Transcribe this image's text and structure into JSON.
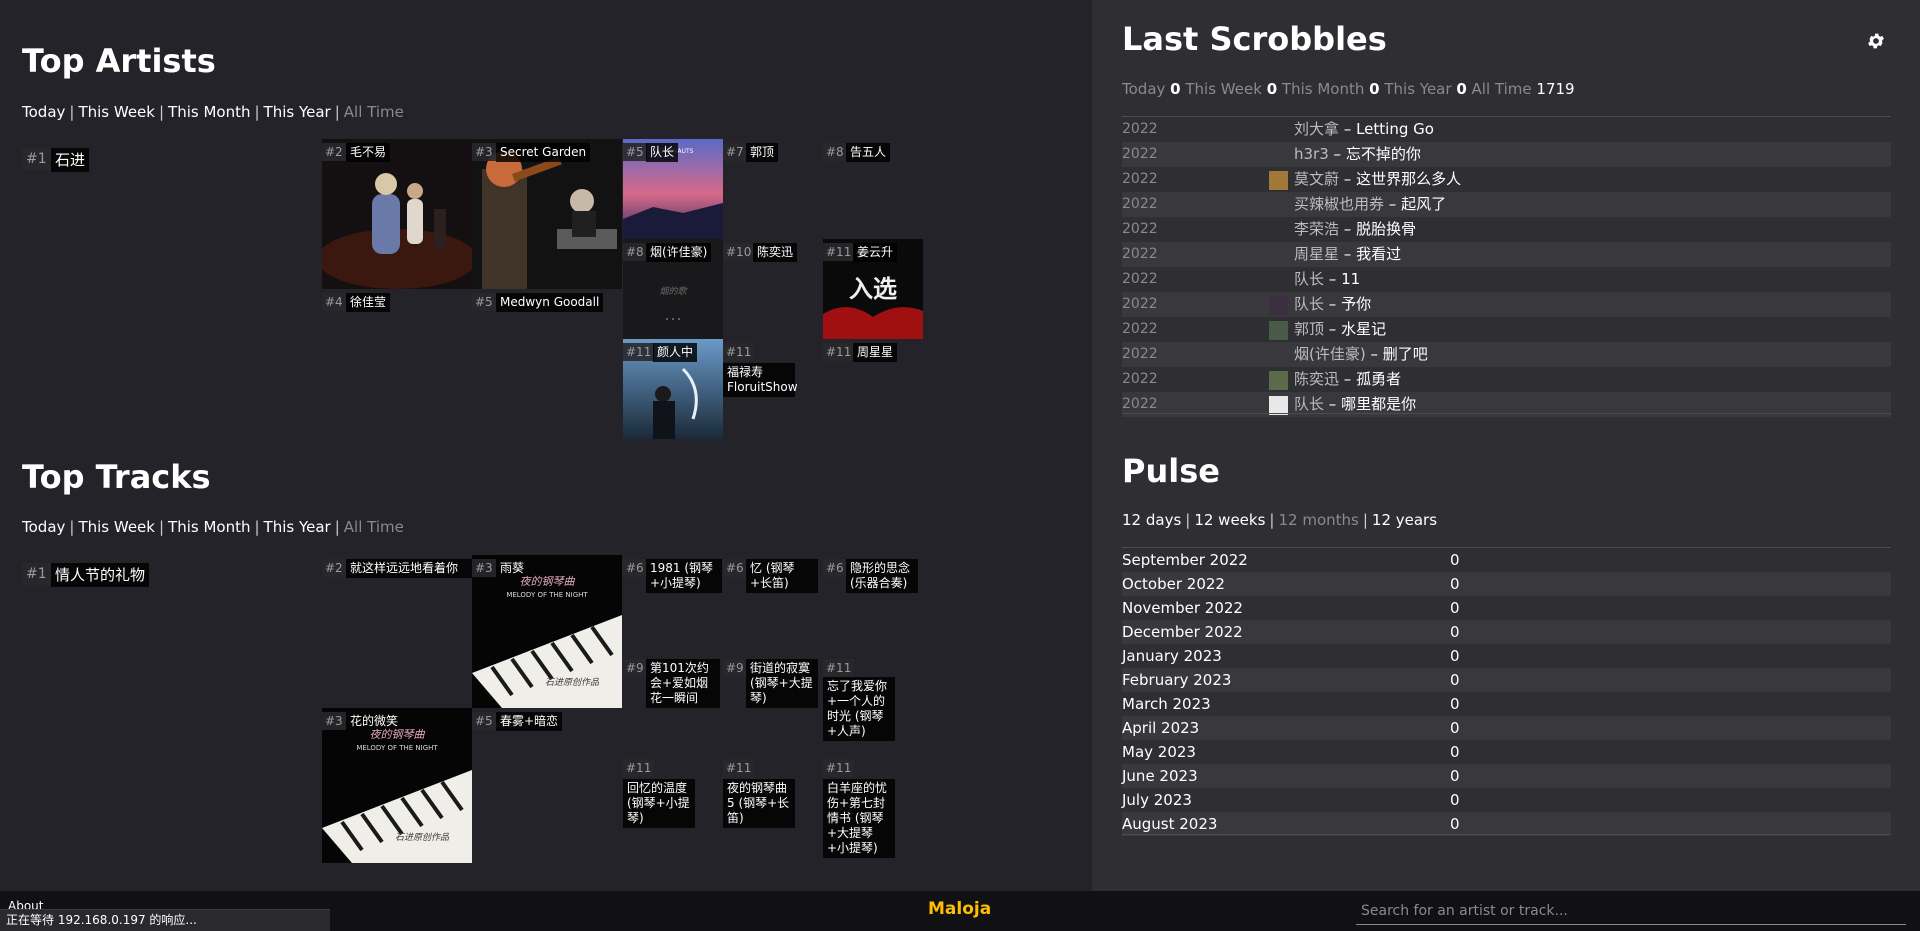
{
  "artists": {
    "title": "Top Artists",
    "ranges": [
      "Today",
      "This Week",
      "This Month",
      "This Year",
      "All Time"
    ],
    "tiles": [
      {
        "rank": "#1",
        "name": "石进"
      },
      {
        "rank": "#2",
        "name": "毛不易"
      },
      {
        "rank": "#3",
        "name": "Secret Garden"
      },
      {
        "rank": "#4",
        "name": "徐佳莹"
      },
      {
        "rank": "#5",
        "name": "Medwyn Goodall"
      },
      {
        "rank": "#5",
        "name": "队长"
      },
      {
        "rank": "#7",
        "name": "郭顶"
      },
      {
        "rank": "#8",
        "name": "告五人"
      },
      {
        "rank": "#8",
        "name": "烟(许佳豪)"
      },
      {
        "rank": "#10",
        "name": "陈奕迅"
      },
      {
        "rank": "#11",
        "name": "姜云升"
      },
      {
        "rank": "#11",
        "name": "颜人中"
      },
      {
        "rank": "#11",
        "name": "福禄寿 FloruitShow"
      },
      {
        "rank": "#11",
        "name": "周星星"
      }
    ],
    "art_texts": {
      "astronaut": "ASTRONAUTS",
      "yan": "烟的歌",
      "jiang": "入选"
    }
  },
  "tracks": {
    "title": "Top Tracks",
    "ranges": [
      "Today",
      "This Week",
      "This Month",
      "This Year",
      "All Time"
    ],
    "tiles": [
      {
        "rank": "#1",
        "name": "情人节的礼物"
      },
      {
        "rank": "#2",
        "name": "就这样远远地看着你"
      },
      {
        "rank": "#3",
        "name": "雨葵"
      },
      {
        "rank": "#6",
        "name": "1981 (钢琴+小提琴)"
      },
      {
        "rank": "#6",
        "name": "忆 (钢琴+长笛)"
      },
      {
        "rank": "#6",
        "name": "隐形的思念 (乐器合奏)"
      },
      {
        "rank": "#9",
        "name": "第101次约会+爱如烟花一瞬间"
      },
      {
        "rank": "#9",
        "name": "街道的寂寞 (钢琴+大提琴)"
      },
      {
        "rank": "#11",
        "name": "忘了我爱你+一个人的时光 (钢琴+人声)"
      },
      {
        "rank": "#3",
        "name": "花的微笑"
      },
      {
        "rank": "#5",
        "name": "春雾+暗恋"
      },
      {
        "rank": "#11",
        "name": "回忆的温度 (钢琴+小提琴)"
      },
      {
        "rank": "#11",
        "name": "夜的钢琴曲5 (钢琴+长笛)"
      },
      {
        "rank": "#11",
        "name": "白羊座的忧伤+第七封情书 (钢琴+大提琴+小提琴)"
      }
    ],
    "cover_texts": {
      "title": "夜的钢琴曲",
      "subtitle": "MELODY OF THE NIGHT",
      "caption": "石进原创作品"
    }
  },
  "scrobbles": {
    "title": "Last Scrobbles",
    "settings_icon": "gear-icon",
    "stats": {
      "today_label": "Today",
      "today": "0",
      "week_label": "This Week",
      "week": "0",
      "month_label": "This Month",
      "month": "0",
      "year_label": "This Year",
      "year": "0",
      "all_label": "All Time",
      "all": "1719"
    },
    "rows": [
      {
        "time": "2022",
        "artist": "刘大拿",
        "title": "Letting Go",
        "thumb": ""
      },
      {
        "time": "2022",
        "artist": "h3r3",
        "title": "忘不掉的你",
        "thumb": ""
      },
      {
        "time": "2022",
        "artist": "莫文蔚",
        "title": "这世界那么多人",
        "thumb": "#a07838"
      },
      {
        "time": "2022",
        "artist": "买辣椒也用券",
        "title": "起风了",
        "thumb": ""
      },
      {
        "time": "2022",
        "artist": "李荣浩",
        "title": "脱胎换骨",
        "thumb": ""
      },
      {
        "time": "2022",
        "artist": "周星星",
        "title": "我看过",
        "thumb": ""
      },
      {
        "time": "2022",
        "artist": "队长",
        "title": "11",
        "thumb": ""
      },
      {
        "time": "2022",
        "artist": "队长",
        "title": "予你",
        "thumb": "#3a3040"
      },
      {
        "time": "2022",
        "artist": "郭顶",
        "title": "水星记",
        "thumb": "#4a5a48"
      },
      {
        "time": "2022",
        "artist": "烟(许佳豪)",
        "title": "删了吧",
        "thumb": ""
      },
      {
        "time": "2022",
        "artist": "陈奕迅",
        "title": "孤勇者",
        "thumb": "#5a6a4a"
      },
      {
        "time": "2022",
        "artist": "队长",
        "title": "哪里都是你",
        "thumb": "#e8e8e8"
      }
    ]
  },
  "pulse": {
    "title": "Pulse",
    "ranges": [
      "12 days",
      "12 weeks",
      "12 months",
      "12 years"
    ],
    "rows": [
      {
        "label": "September 2022",
        "value": "0"
      },
      {
        "label": "October 2022",
        "value": "0"
      },
      {
        "label": "November 2022",
        "value": "0"
      },
      {
        "label": "December 2022",
        "value": "0"
      },
      {
        "label": "January 2023",
        "value": "0"
      },
      {
        "label": "February 2023",
        "value": "0"
      },
      {
        "label": "March 2023",
        "value": "0"
      },
      {
        "label": "April 2023",
        "value": "0"
      },
      {
        "label": "May 2023",
        "value": "0"
      },
      {
        "label": "June 2023",
        "value": "0"
      },
      {
        "label": "July 2023",
        "value": "0"
      },
      {
        "label": "August 2023",
        "value": "0"
      }
    ]
  },
  "footer": {
    "about": "About",
    "brand": "Maloja",
    "search_placeholder": "Search for an artist or track...",
    "status": "正在等待 192.168.0.197 的响应..."
  },
  "colors": {
    "left_bg": "#232329",
    "right_bg": "#2f2f33",
    "brand": "#ffbf00",
    "dim_text": "#8a8a8a"
  }
}
